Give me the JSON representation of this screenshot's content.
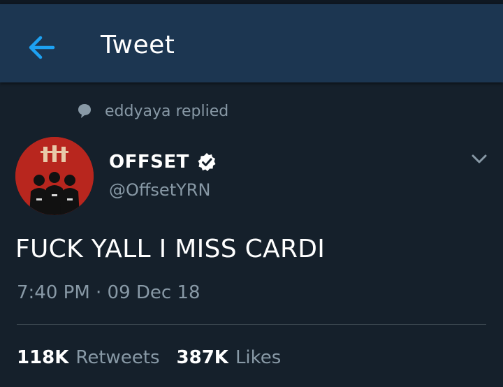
{
  "header": {
    "title": "Tweet",
    "back_icon": "back-arrow-icon",
    "accent_color": "#1da1f2"
  },
  "context": {
    "icon": "speech-bubble-icon",
    "text": "eddyaya replied"
  },
  "author": {
    "display_name": "OFFSET",
    "handle": "@OffsetYRN",
    "verified": true,
    "verified_icon": "verified-badge-icon",
    "avatar_icon": "avatar-image"
  },
  "menu": {
    "icon": "chevron-down-icon"
  },
  "tweet": {
    "text": "FUCK YALL I MISS CARDI",
    "timestamp": "7:40 PM · 09 Dec 18"
  },
  "stats": {
    "retweets_count": "118K",
    "retweets_label": "Retweets",
    "likes_count": "387K",
    "likes_label": "Likes"
  },
  "colors": {
    "background": "#15202b",
    "header": "#1c3651",
    "secondary_text": "#8899a6",
    "divider": "#38444d"
  }
}
